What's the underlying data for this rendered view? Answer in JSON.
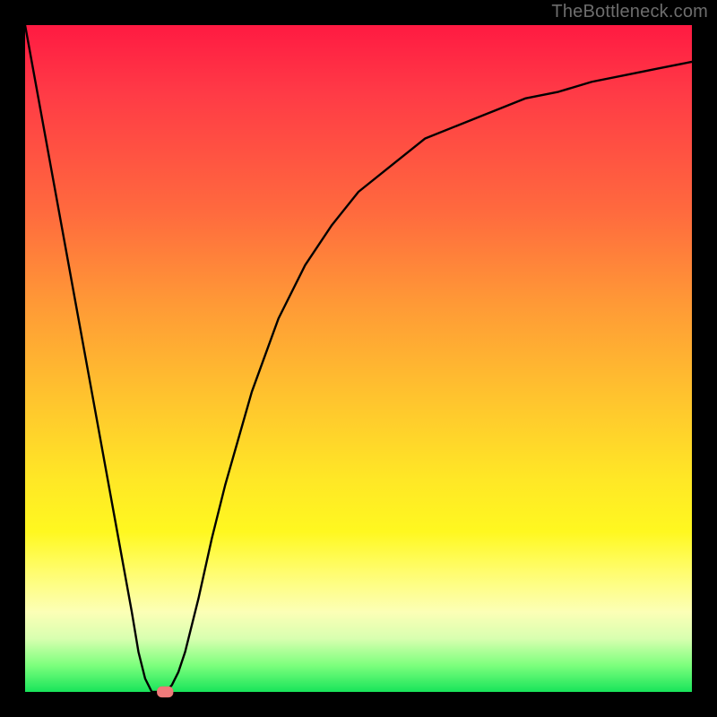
{
  "watermark": "TheBottleneck.com",
  "chart_data": {
    "type": "line",
    "title": "",
    "xlabel": "",
    "ylabel": "",
    "x_range": [
      0,
      100
    ],
    "y_range": [
      0,
      100
    ],
    "grid": false,
    "legend": false,
    "background_gradient": {
      "direction": "vertical",
      "stops": [
        {
          "pos": 0,
          "color": "#ff1a42"
        },
        {
          "pos": 28,
          "color": "#ff6a3e"
        },
        {
          "pos": 56,
          "color": "#ffc42e"
        },
        {
          "pos": 76,
          "color": "#fff820"
        },
        {
          "pos": 88,
          "color": "#fcffb6"
        },
        {
          "pos": 96,
          "color": "#7dff7d"
        },
        {
          "pos": 100,
          "color": "#18e45a"
        }
      ]
    },
    "series": [
      {
        "name": "bottleneck-curve",
        "color": "#000000",
        "x": [
          0,
          2,
          4,
          6,
          8,
          10,
          12,
          14,
          16,
          17,
          18,
          19,
          20,
          21,
          22,
          23,
          24,
          26,
          28,
          30,
          34,
          38,
          42,
          46,
          50,
          55,
          60,
          65,
          70,
          75,
          80,
          85,
          90,
          95,
          100
        ],
        "y": [
          100,
          89,
          78,
          67,
          56,
          45,
          34,
          23,
          12,
          6,
          2,
          0,
          0,
          0,
          1,
          3,
          6,
          14,
          23,
          31,
          45,
          56,
          64,
          70,
          75,
          79,
          83,
          85,
          87,
          89,
          90,
          91.5,
          92.5,
          93.5,
          94.5
        ]
      }
    ],
    "marker": {
      "name": "highlight-point",
      "x": 21,
      "y": 0,
      "color": "#ef7a7a",
      "shape": "rounded-rect",
      "width": 2.4,
      "height": 1.6
    }
  }
}
